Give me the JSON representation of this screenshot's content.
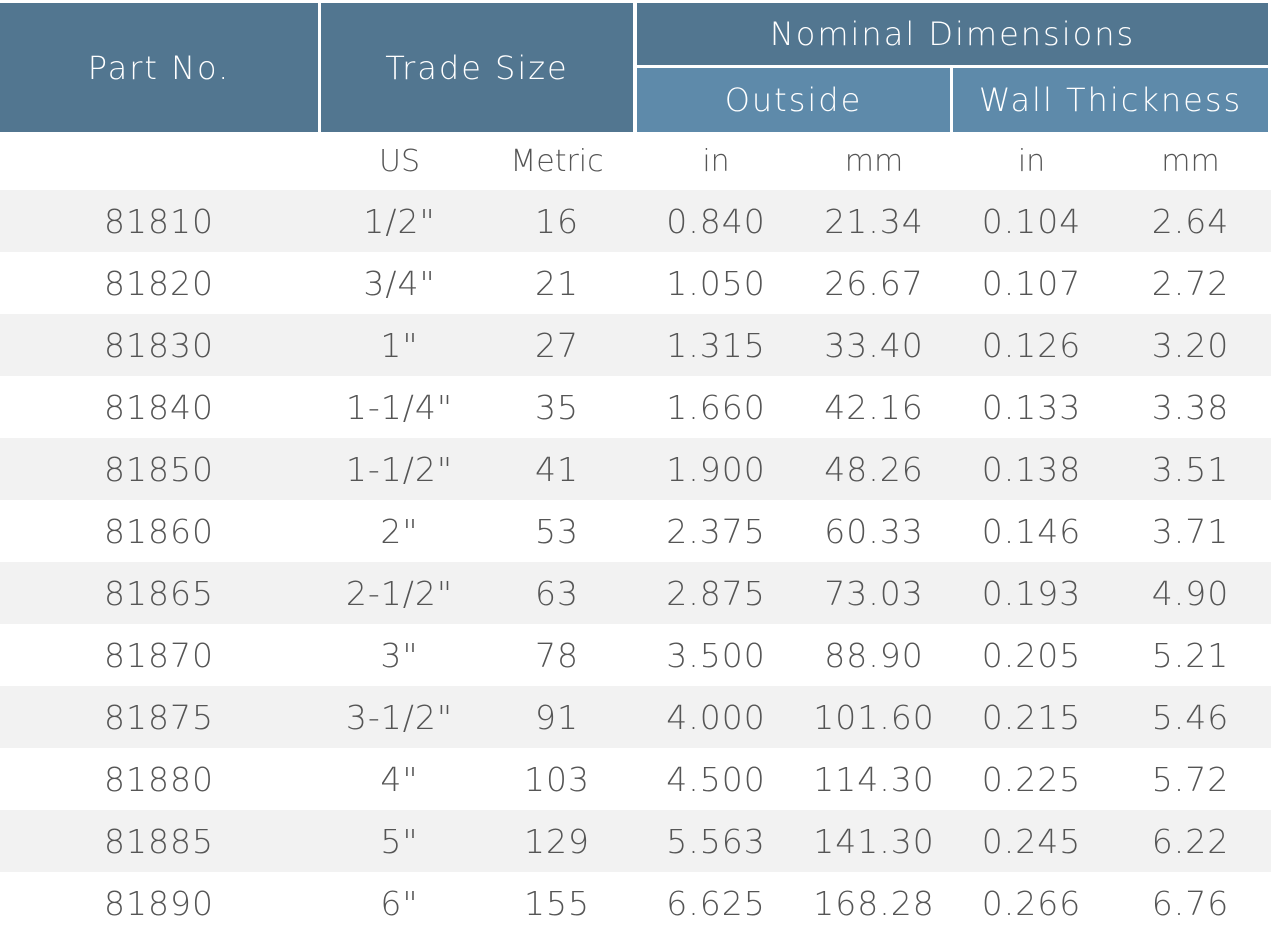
{
  "header": {
    "part_no": "Part No.",
    "trade_size": "Trade Size",
    "nominal_dimensions": "Nominal Dimensions",
    "outside": "Outside",
    "wall_thickness": "Wall Thickness"
  },
  "units": [
    "",
    "US",
    "Metric",
    "in",
    "mm",
    "in",
    "mm"
  ],
  "colors": {
    "header_dark": "#527690",
    "header_light": "#5e8aaa",
    "row_alt": "#f2f2f2",
    "text": "#555555"
  },
  "rows": [
    [
      "81810",
      "1/2\"",
      "16",
      "0.840",
      "21.34",
      "0.104",
      "2.64"
    ],
    [
      "81820",
      "3/4\"",
      "21",
      "1.050",
      "26.67",
      "0.107",
      "2.72"
    ],
    [
      "81830",
      "1\"",
      "27",
      "1.315",
      "33.40",
      "0.126",
      "3.20"
    ],
    [
      "81840",
      "1-1/4\"",
      "35",
      "1.660",
      "42.16",
      "0.133",
      "3.38"
    ],
    [
      "81850",
      "1-1/2\"",
      "41",
      "1.900",
      "48.26",
      "0.138",
      "3.51"
    ],
    [
      "81860",
      "2\"",
      "53",
      "2.375",
      "60.33",
      "0.146",
      "3.71"
    ],
    [
      "81865",
      "2-1/2\"",
      "63",
      "2.875",
      "73.03",
      "0.193",
      "4.90"
    ],
    [
      "81870",
      "3\"",
      "78",
      "3.500",
      "88.90",
      "0.205",
      "5.21"
    ],
    [
      "81875",
      "3-1/2\"",
      "91",
      "4.000",
      "101.60",
      "0.215",
      "5.46"
    ],
    [
      "81880",
      "4\"",
      "103",
      "4.500",
      "114.30",
      "0.225",
      "5.72"
    ],
    [
      "81885",
      "5\"",
      "129",
      "5.563",
      "141.30",
      "0.245",
      "6.22"
    ],
    [
      "81890",
      "6\"",
      "155",
      "6.625",
      "168.28",
      "0.266",
      "6.76"
    ]
  ]
}
